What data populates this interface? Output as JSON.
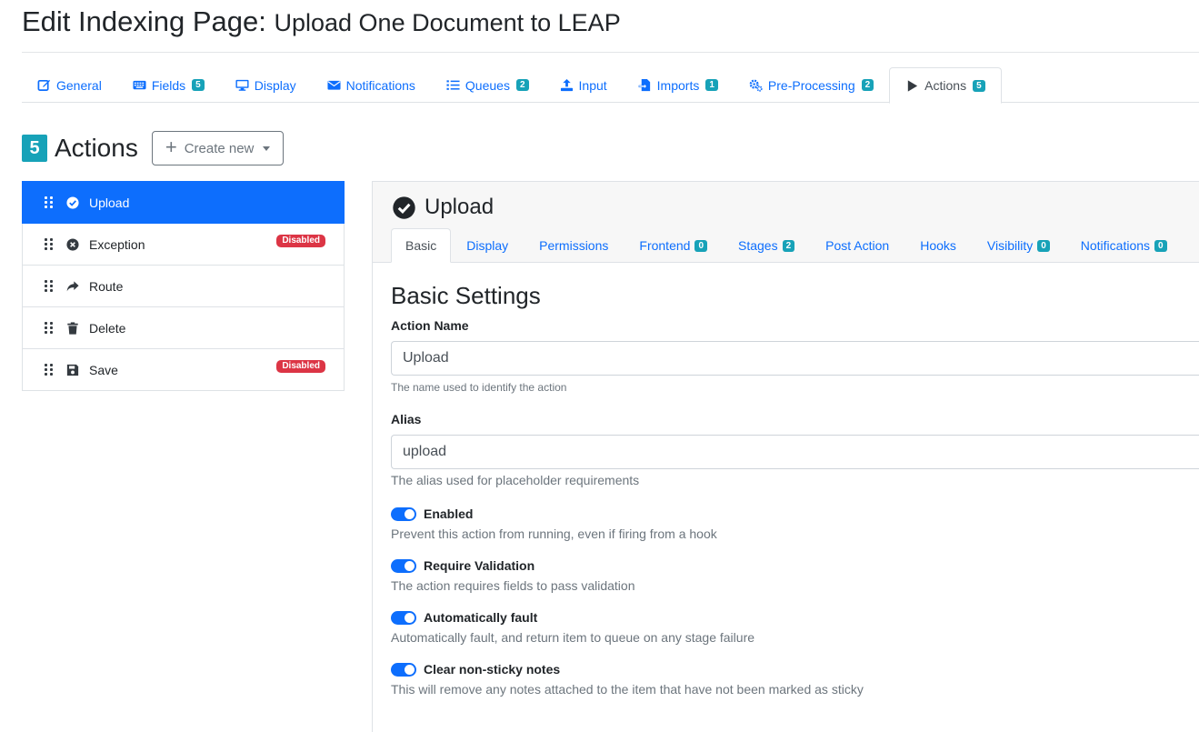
{
  "page": {
    "title_prefix": "Edit Indexing Page: ",
    "title_name": "Upload One Document to LEAP"
  },
  "main_tabs": [
    {
      "label": "General",
      "icon": "edit-icon",
      "badge": ""
    },
    {
      "label": "Fields",
      "icon": "keyboard-icon",
      "badge": "5"
    },
    {
      "label": "Display",
      "icon": "monitor-icon",
      "badge": ""
    },
    {
      "label": "Notifications",
      "icon": "envelope-icon",
      "badge": ""
    },
    {
      "label": "Queues",
      "icon": "list-icon",
      "badge": "2"
    },
    {
      "label": "Input",
      "icon": "upload-icon",
      "badge": ""
    },
    {
      "label": "Imports",
      "icon": "file-import-icon",
      "badge": "1"
    },
    {
      "label": "Pre-Processing",
      "icon": "cogs-icon",
      "badge": "2"
    },
    {
      "label": "Actions",
      "icon": "play-icon",
      "badge": "5"
    }
  ],
  "actions_header": {
    "count": "5",
    "title": "Actions",
    "create_label": "Create new"
  },
  "actions": [
    {
      "label": "Upload",
      "icon": "check-circle-icon",
      "badge": ""
    },
    {
      "label": "Exception",
      "icon": "times-circle-icon",
      "badge": "Disabled"
    },
    {
      "label": "Route",
      "icon": "share-arrow-icon",
      "badge": ""
    },
    {
      "label": "Delete",
      "icon": "trash-icon",
      "badge": ""
    },
    {
      "label": "Save",
      "icon": "save-icon",
      "badge": "Disabled"
    }
  ],
  "detail": {
    "title": "Upload",
    "tabs": [
      {
        "label": "Basic",
        "badge": ""
      },
      {
        "label": "Display",
        "badge": ""
      },
      {
        "label": "Permissions",
        "badge": ""
      },
      {
        "label": "Frontend",
        "badge": "0"
      },
      {
        "label": "Stages",
        "badge": "2"
      },
      {
        "label": "Post Action",
        "badge": ""
      },
      {
        "label": "Hooks",
        "badge": ""
      },
      {
        "label": "Visibility",
        "badge": "0"
      },
      {
        "label": "Notifications",
        "badge": "0"
      }
    ],
    "section_title": "Basic Settings",
    "action_name_label": "Action Name",
    "action_name_value": "Upload",
    "action_name_help": "The name used to identify the action",
    "alias_label": "Alias",
    "alias_value": "upload",
    "alias_help": "The alias used for placeholder requirements",
    "switches": [
      {
        "label": "Enabled",
        "help": "Prevent this action from running, even if firing from a hook",
        "on": true
      },
      {
        "label": "Require Validation",
        "help": "The action requires fields to pass validation",
        "on": true
      },
      {
        "label": "Automatically fault",
        "help": "Automatically fault, and return item to queue on any stage failure",
        "on": true
      },
      {
        "label": "Clear non-sticky notes",
        "help": "This will remove any notes attached to the item that have not been marked as sticky",
        "on": true
      }
    ]
  },
  "colors": {
    "primary": "#0d6efd",
    "info_badge": "#17a2b8",
    "danger_badge": "#dc3545"
  }
}
